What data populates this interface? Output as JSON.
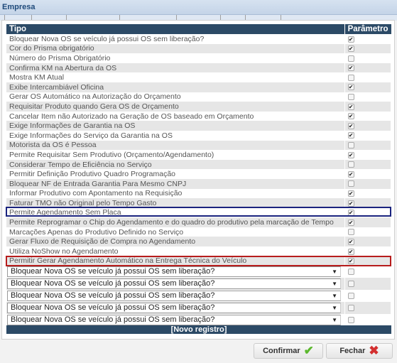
{
  "window": {
    "title": "Empresa"
  },
  "table": {
    "headers": {
      "tipo": "Tipo",
      "parametro": "Parâmetro"
    },
    "rows": [
      {
        "label": "Bloquear Nova OS se veículo já possui OS sem liberação?",
        "checked": true
      },
      {
        "label": "Cor do Prisma obrigatório",
        "checked": true
      },
      {
        "label": "Número do Prisma Obrigatório",
        "checked": false
      },
      {
        "label": "Confirma KM na Abertura da OS",
        "checked": true
      },
      {
        "label": "Mostra KM Atual",
        "checked": false
      },
      {
        "label": "Exibe Intercambiável Oficina",
        "checked": true
      },
      {
        "label": "Gerar OS Automático na Autorização do Orçamento",
        "checked": false
      },
      {
        "label": "Requisitar Produto quando Gera OS de Orçamento",
        "checked": true
      },
      {
        "label": "Cancelar Item não Autorizado na Geração de OS baseado em Orçamento",
        "checked": true
      },
      {
        "label": "Exige Informações de Garantia na OS",
        "checked": true
      },
      {
        "label": "Exige Informações do Serviço da Garantia na OS",
        "checked": true
      },
      {
        "label": "Motorista da OS é Pessoa",
        "checked": false
      },
      {
        "label": "Permite Requisitar Sem Produtivo (Orçamento/Agendamento)",
        "checked": true
      },
      {
        "label": "Considerar Tempo de Eficiência no Serviço",
        "checked": false
      },
      {
        "label": "Permitir Definição Produtivo Quadro Programação",
        "checked": true
      },
      {
        "label": "Bloquear NF de Entrada Garantia Para Mesmo CNPJ",
        "checked": false
      },
      {
        "label": "Informar Produtivo com Apontamento na Requisição",
        "checked": true
      },
      {
        "label": "Faturar TMO não Original pelo Tempo Gasto",
        "checked": true
      },
      {
        "label": "Permite Agendamento Sem Placa",
        "checked": true
      },
      {
        "label": "Permite Reprogramar o Chip do Agendamento e do quadro do produtivo pela marcação de Tempo",
        "checked": true
      },
      {
        "label": "Marcações Apenas do Produtivo Definido no Serviço",
        "checked": false
      },
      {
        "label": "Gerar Fluxo de Requisição de Compra no Agendamento",
        "checked": true
      },
      {
        "label": "Utiliza NoShow no Agendamento",
        "checked": true
      },
      {
        "label": "Permitir Gerar Agendamento Automático na Entrega Técnica do Veículo",
        "checked": true
      }
    ],
    "new_rows": [
      {
        "value": "Bloquear Nova OS se veículo já possui OS sem liberação?",
        "checked": false
      },
      {
        "value": "Bloquear Nova OS se veículo já possui OS sem liberação?",
        "checked": false
      },
      {
        "value": "Bloquear Nova OS se veículo já possui OS sem liberação?",
        "checked": false
      },
      {
        "value": "Bloquear Nova OS se veículo já possui OS sem liberação?",
        "checked": false
      },
      {
        "value": "Bloquear Nova OS se veículo já possui OS sem liberação?",
        "checked": false
      }
    ],
    "new_record": "[Novo registro]"
  },
  "buttons": {
    "confirm": "Confirmar",
    "close": "Fechar"
  },
  "colors": {
    "header": "#2c4a66",
    "highlight_blue": "#1a237e",
    "highlight_red": "#b71c1c",
    "confirm_icon": "#5cb82e",
    "close_icon": "#d32f2f"
  }
}
